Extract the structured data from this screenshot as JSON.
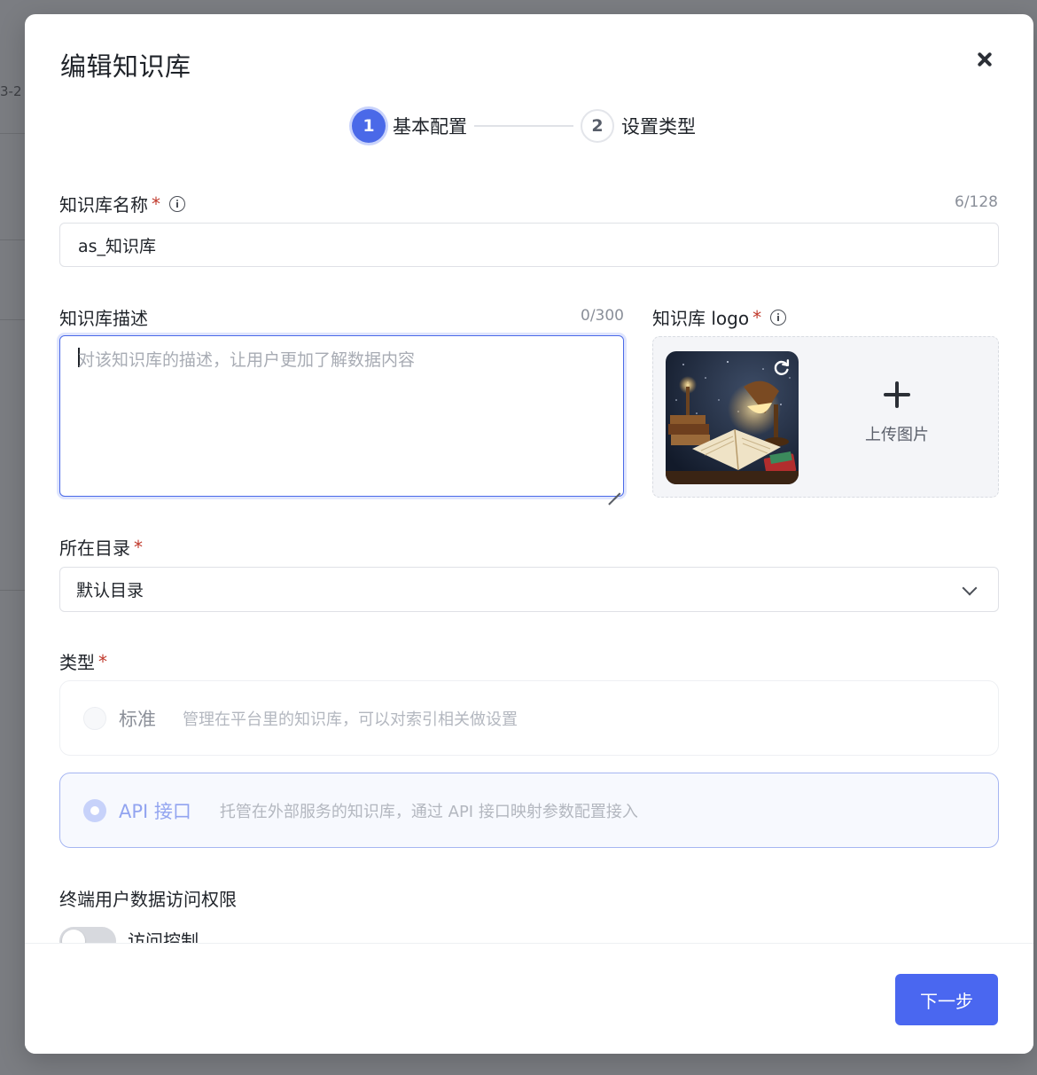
{
  "background": {
    "fragment_text": "3-2"
  },
  "modal": {
    "title": "编辑知识库",
    "close_icon": "close-icon"
  },
  "steps": [
    {
      "number": "1",
      "label": "基本配置",
      "state": "active"
    },
    {
      "number": "2",
      "label": "设置类型",
      "state": "inactive"
    }
  ],
  "form": {
    "name": {
      "label": "知识库名称",
      "required_mark": "*",
      "value": "as_知识库",
      "counter": "6/128"
    },
    "description": {
      "label": "知识库描述",
      "counter": "0/300",
      "placeholder": "对该知识库的描述，让用户更加了解数据内容",
      "value": ""
    },
    "logo": {
      "label": "知识库 logo",
      "required_mark": "*",
      "upload_label": "上传图片",
      "image_subject": "book-and-desk-lamp-illustration"
    },
    "directory": {
      "label": "所在目录",
      "required_mark": "*",
      "selected": "默认目录"
    },
    "type": {
      "label": "类型",
      "required_mark": "*",
      "options": [
        {
          "name": "标准",
          "desc": "管理在平台里的知识库，可以对索引相关做设置",
          "selected": false
        },
        {
          "name": "API 接口",
          "desc": "托管在外部服务的知识库，通过 API 接口映射参数配置接入",
          "selected": true
        }
      ]
    },
    "access": {
      "section_label": "终端用户数据访问权限",
      "toggle_label": "访问控制",
      "enabled": false
    }
  },
  "footer": {
    "next_label": "下一步"
  },
  "colors": {
    "primary": "#4a67f0",
    "required": "#c0392b",
    "overlay": "#7b7d82"
  }
}
